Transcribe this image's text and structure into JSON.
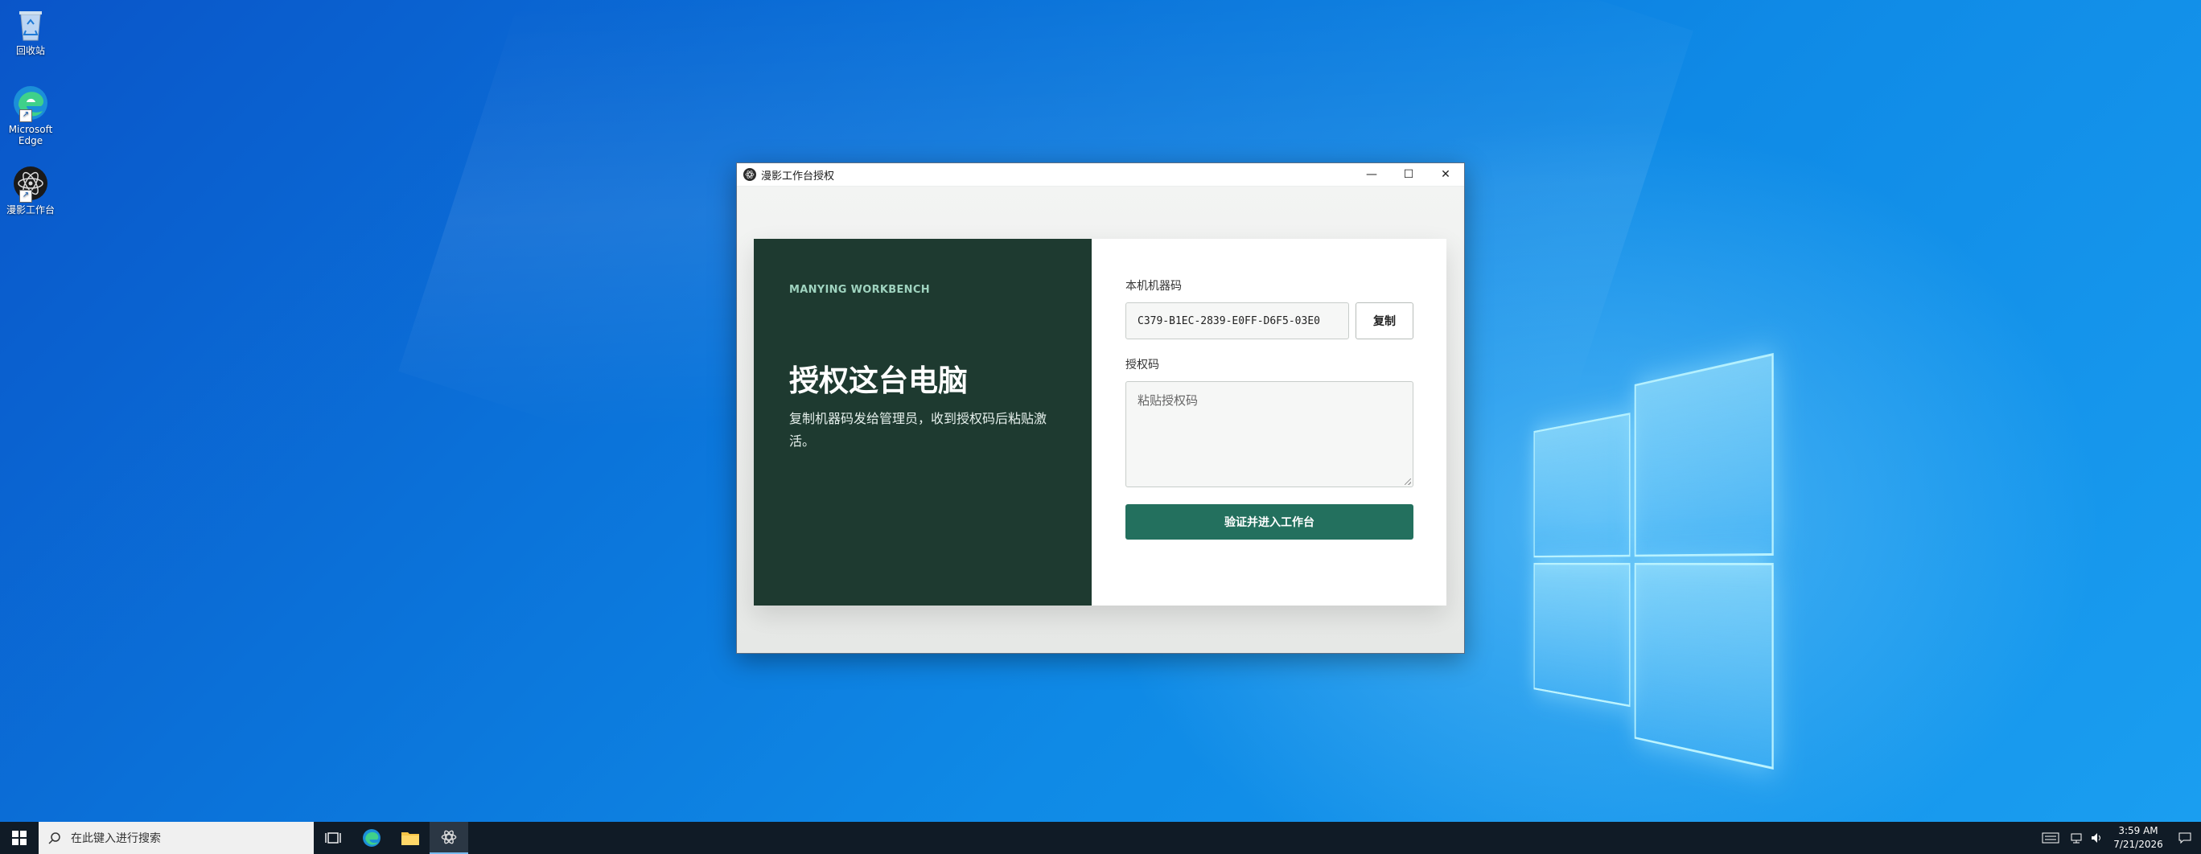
{
  "desktop": {
    "icons": [
      {
        "label": "回收站"
      },
      {
        "label": "Microsoft Edge"
      },
      {
        "label": "漫影工作台"
      }
    ]
  },
  "window": {
    "title": "漫影工作台授权",
    "controls": {
      "minimize": "—",
      "maximize": "☐",
      "close": "✕"
    }
  },
  "left": {
    "eyebrow": "MANYING WORKBENCH",
    "headline": "授权这台电脑",
    "description": "复制机器码发给管理员，收到授权码后粘贴激活。"
  },
  "form": {
    "machine_label": "本机机器码",
    "machine_code": "C379-B1EC-2839-E0FF-D6F5-03E0",
    "copy_label": "复制",
    "license_label": "授权码",
    "license_placeholder": "粘贴授权码",
    "submit_label": "验证并进入工作台"
  },
  "taskbar": {
    "search_placeholder": "在此键入进行搜索",
    "time": "3:59 AM",
    "date": "7/21/2026"
  },
  "colors": {
    "panel_dark": "#1e3a30",
    "accent_green": "#23705e",
    "eyebrow": "#9fd3bf"
  }
}
